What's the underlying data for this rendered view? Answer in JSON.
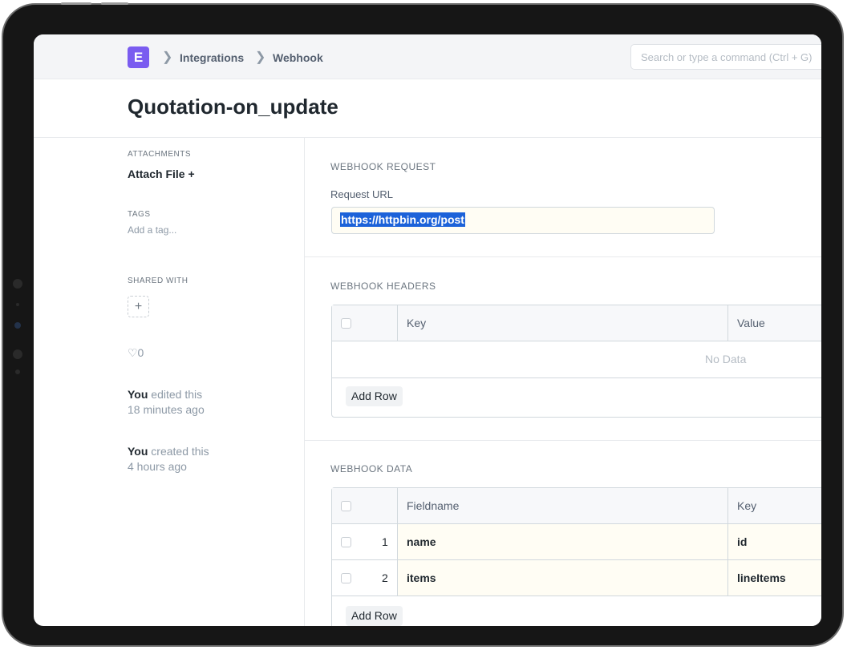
{
  "navbar": {
    "logo_letter": "E",
    "breadcrumbs": [
      "Integrations",
      "Webhook"
    ],
    "search_placeholder": "Search or type a command (Ctrl + G)"
  },
  "page": {
    "title": "Quotation-on_update"
  },
  "sidebar": {
    "attachments_label": "ATTACHMENTS",
    "attach_file": "Attach File +",
    "tags_label": "TAGS",
    "add_tag": "Add a tag...",
    "shared_with_label": "SHARED WITH",
    "share_add": "+",
    "likes": "♡0",
    "activity": [
      {
        "who": "You",
        "action": " edited this",
        "when": "18 minutes ago"
      },
      {
        "who": "You",
        "action": " created this",
        "when": "4 hours ago"
      }
    ]
  },
  "webhook_request": {
    "section_label": "WEBHOOK REQUEST",
    "field_label": "Request URL",
    "url": "https://httpbin.org/post"
  },
  "webhook_headers": {
    "section_label": "WEBHOOK HEADERS",
    "columns": [
      "Key",
      "Value"
    ],
    "empty_text": "No Data",
    "add_row": "Add Row"
  },
  "webhook_data": {
    "section_label": "WEBHOOK DATA",
    "columns": [
      "Fieldname",
      "Key"
    ],
    "rows": [
      {
        "idx": "1",
        "fieldname": "name",
        "key": "id"
      },
      {
        "idx": "2",
        "fieldname": "items",
        "key": "lineItems"
      }
    ],
    "add_row": "Add Row"
  },
  "colors": {
    "brand": "#7a5cf0",
    "selection": "#1c62d9",
    "input_bg": "#fffdf4"
  }
}
